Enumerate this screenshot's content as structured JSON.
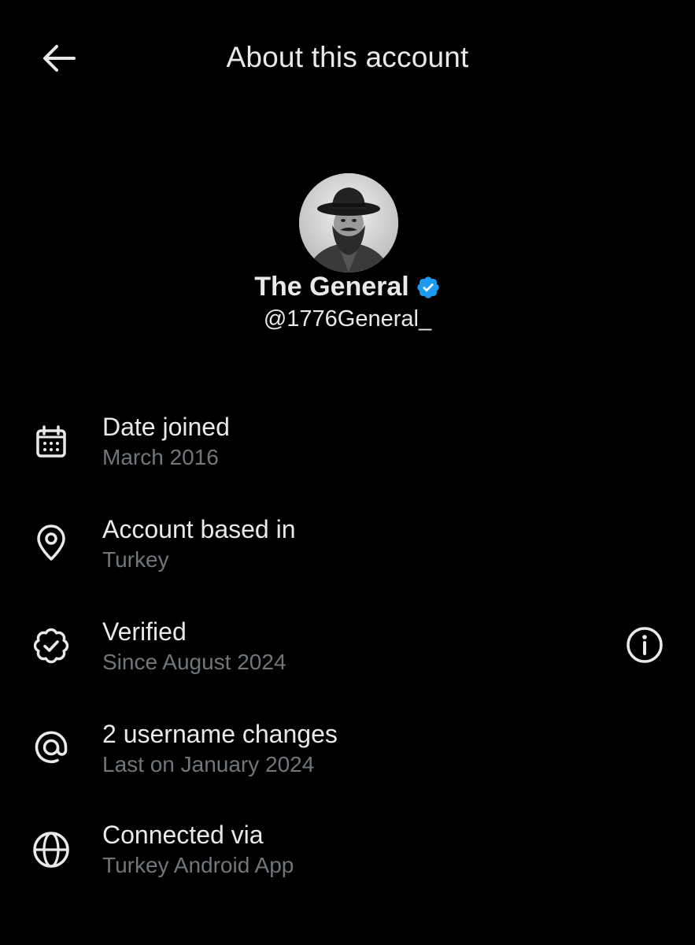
{
  "header": {
    "title": "About this account",
    "back_icon": "arrow-left-icon"
  },
  "profile": {
    "display_name": "The General",
    "handle": "@1776General_",
    "verified_icon": "verified-badge-icon",
    "avatar_alt": "Profile photo of a man with a beard wearing a hat"
  },
  "rows": [
    {
      "icon": "calendar-icon",
      "title": "Date joined",
      "subtitle": "March 2016"
    },
    {
      "icon": "location-pin-icon",
      "title": "Account based in",
      "subtitle": "Turkey"
    },
    {
      "icon": "verified-seal-icon",
      "title": "Verified",
      "subtitle": "Since August 2024",
      "action_icon": "info-icon"
    },
    {
      "icon": "at-sign-icon",
      "title": "2 username changes",
      "subtitle": "Last on January 2024"
    },
    {
      "icon": "globe-icon",
      "title": "Connected via",
      "subtitle": "Turkey Android App"
    }
  ],
  "colors": {
    "background": "#000000",
    "primary_text": "#e7e9ea",
    "secondary_text": "#71767b",
    "verified_blue": "#1d9bf0"
  }
}
